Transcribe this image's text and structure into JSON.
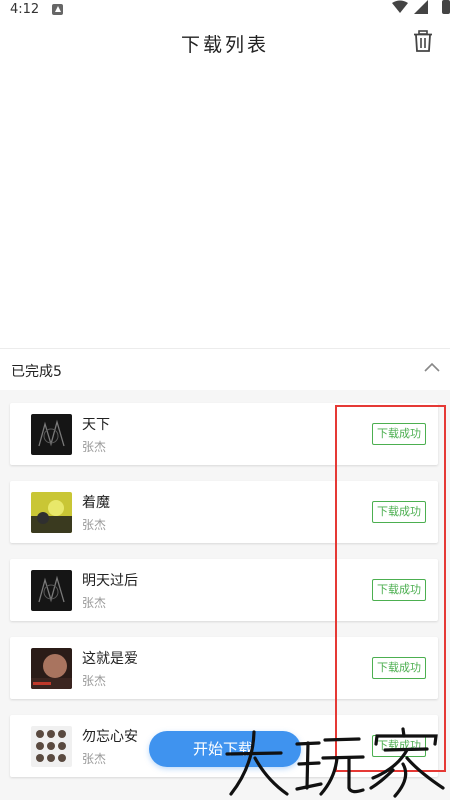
{
  "status_bar": {
    "time": "4:12",
    "icons": [
      "notification-icon",
      "wifi-icon",
      "signal-icon",
      "battery-icon"
    ]
  },
  "header": {
    "title": "下载列表",
    "action_icon": "trash-icon"
  },
  "section": {
    "label": "已完成",
    "count": "5",
    "toggle_icon": "chevron-up-icon"
  },
  "items": [
    {
      "title": "天下",
      "artist": "张杰",
      "status": "下载成功"
    },
    {
      "title": "着魔",
      "artist": "张杰",
      "status": "下载成功"
    },
    {
      "title": "明天过后",
      "artist": "张杰",
      "status": "下载成功"
    },
    {
      "title": "这就是爱",
      "artist": "张杰",
      "status": "下载成功"
    },
    {
      "title": "勿忘心安",
      "artist": "张杰",
      "status": "下载成功"
    }
  ],
  "primary_button": {
    "label": "开始下载"
  },
  "colors": {
    "accent": "#3f93ef",
    "success": "#4caf50",
    "highlight": "#e53935"
  },
  "watermark": {
    "text": "大玩家"
  }
}
